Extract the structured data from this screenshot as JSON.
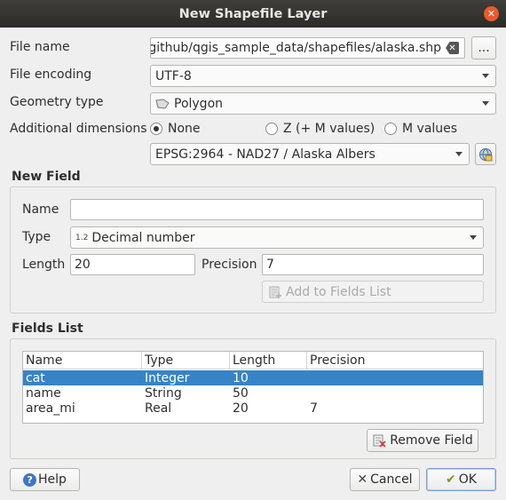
{
  "window": {
    "title": "New Shapefile Layer"
  },
  "form": {
    "file_name_label": "File name",
    "file_name_value": "/github/qgis_sample_data/shapefiles/alaska.shp",
    "browse_label": "...",
    "file_encoding_label": "File encoding",
    "file_encoding_value": "UTF-8",
    "geometry_type_label": "Geometry type",
    "geometry_type_value": "Polygon",
    "additional_dimensions_label": "Additional dimensions",
    "dim_none": "None",
    "dim_z": "Z (+ M values)",
    "dim_m": "M values",
    "dim_selected": "None",
    "crs_value": "EPSG:2964 - NAD27 / Alaska Albers"
  },
  "new_field": {
    "title": "New Field",
    "name_label": "Name",
    "name_value": "",
    "type_label": "Type",
    "type_prefix": "1.2",
    "type_value": "Decimal number",
    "length_label": "Length",
    "length_value": "20",
    "precision_label": "Precision",
    "precision_value": "7",
    "add_button": "Add to Fields List"
  },
  "fields_list": {
    "title": "Fields List",
    "columns": [
      "Name",
      "Type",
      "Length",
      "Precision"
    ],
    "rows": [
      {
        "name": "cat",
        "type": "Integer",
        "length": "10",
        "precision": "",
        "selected": true
      },
      {
        "name": "name",
        "type": "String",
        "length": "50",
        "precision": ""
      },
      {
        "name": "area_mi",
        "type": "Real",
        "length": "20",
        "precision": "7"
      }
    ],
    "remove_button": "Remove Field"
  },
  "footer": {
    "help": "Help",
    "cancel": "Cancel",
    "ok": "OK"
  },
  "colors": {
    "selection": "#3584c7",
    "close_button": "#e85a2b",
    "titlebar": "#2c2b28"
  }
}
